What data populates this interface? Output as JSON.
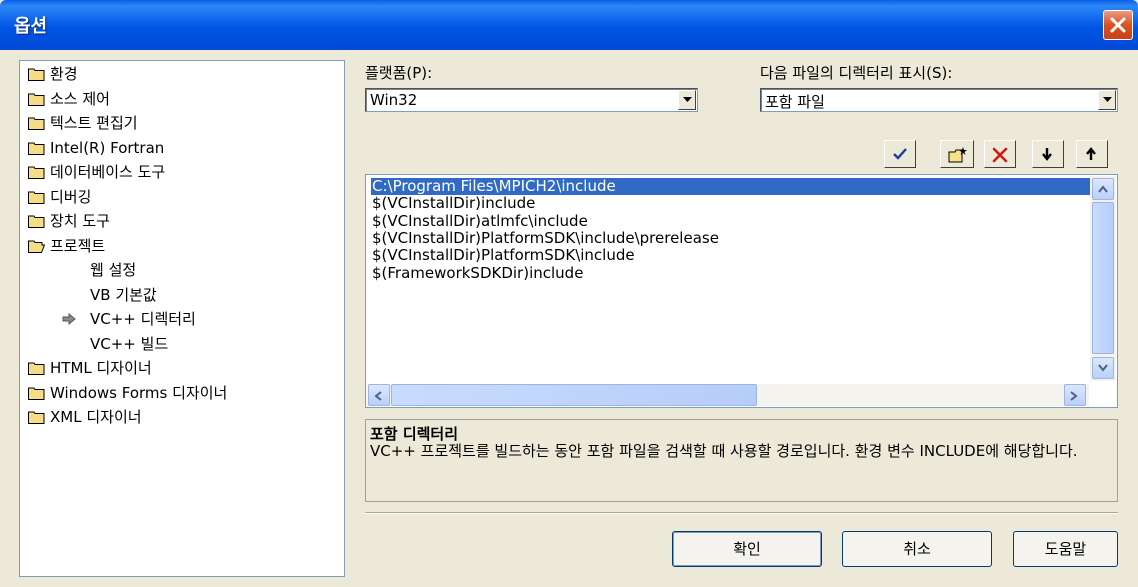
{
  "window": {
    "title": "옵션"
  },
  "tree": {
    "items": [
      {
        "label": "환경",
        "icon": "folder-icon"
      },
      {
        "label": "소스 제어",
        "icon": "folder-icon"
      },
      {
        "label": "텍스트 편집기",
        "icon": "folder-icon"
      },
      {
        "label": "Intel(R) Fortran",
        "icon": "folder-icon"
      },
      {
        "label": "데이터베이스 도구",
        "icon": "folder-icon"
      },
      {
        "label": "디버깅",
        "icon": "folder-icon"
      },
      {
        "label": "장치 도구",
        "icon": "folder-icon"
      },
      {
        "label": "프로젝트",
        "icon": "open-folder-icon"
      },
      {
        "label": "웹 설정"
      },
      {
        "label": "VB 기본값"
      },
      {
        "label": "VC++ 디렉터리",
        "icon": "arrow-icon",
        "selected": true
      },
      {
        "label": "VC++ 빌드"
      },
      {
        "label": "HTML 디자이너",
        "icon": "folder-icon"
      },
      {
        "label": "Windows Forms 디자이너",
        "icon": "folder-icon"
      },
      {
        "label": "XML 디자이너",
        "icon": "folder-icon"
      }
    ]
  },
  "platform": {
    "label": "플랫폼(P):",
    "value": "Win32"
  },
  "dir_show": {
    "label": "다음 파일의 디렉터리 표시(S):",
    "value": "포함 파일"
  },
  "toolbar": [
    "check-icon",
    "new-folder-icon",
    "delete-icon",
    "move-down-icon",
    "move-up-icon"
  ],
  "dir_list": [
    "C:\\Program Files\\MPICH2\\include",
    "$(VCInstallDir)include",
    "$(VCInstallDir)atlmfc\\include",
    "$(VCInstallDir)PlatformSDK\\include\\prerelease",
    "$(VCInstallDir)PlatformSDK\\include",
    "$(FrameworkSDKDir)include"
  ],
  "description": {
    "title": "포함 디렉터리",
    "body": "VC++ 프로젝트를 빌드하는 동안 포함 파일을 검색할 때 사용할 경로입니다. 환경 변수 INCLUDE에 해당합니다."
  },
  "buttons": {
    "ok": "확인",
    "cancel": "취소",
    "help": "도움말"
  },
  "colors": {
    "title_bar": "#0055e5",
    "selection": "#316ac5",
    "dialog_bg": "#ece9d8"
  }
}
